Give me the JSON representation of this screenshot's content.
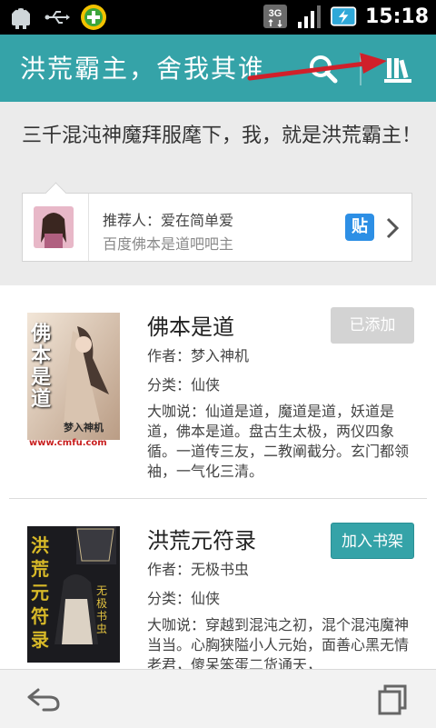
{
  "status_bar": {
    "time": "15:18",
    "network": "3G",
    "icons": [
      "android-icon",
      "usb-icon",
      "app-icon",
      "network-3g-icon",
      "signal-icon",
      "battery-charging-icon"
    ]
  },
  "action_bar": {
    "title": "洪荒霸主，舍我其谁",
    "icons": [
      "search-icon",
      "bookshelf-icon"
    ],
    "accent": "#35a3a8",
    "annotation_arrow_color": "#d0202a"
  },
  "recommendation": {
    "quote": "三千混沌神魔拜服麾下，我，就是洪荒霸主！",
    "recommender": "推荐人：爱在简单爱",
    "forum": "百度佛本是道吧吧主",
    "tie_label": "贴"
  },
  "books": [
    {
      "title": "佛本是道",
      "author": "作者：梦入神机",
      "category": "分类：仙侠",
      "summary": "大咖说：仙道是道，魔道是道，妖道是道，佛本是道。盘古生太极，两仪四象循。一道传三友，二教阐截分。玄门都领袖，一气化三清。",
      "button": "已添加",
      "added": true,
      "cover_text": "佛本是道",
      "cover_author": "梦入神机",
      "cover_url": "www.cmfu.com"
    },
    {
      "title": "洪荒元符录",
      "author": "作者：无极书虫",
      "category": "分类：仙侠",
      "summary": "大咖说：穿越到混沌之初，混个混沌魔神当当。心胸狭隘小人元始，面善心黑无情老君，傻呆笨蛋二货通天，",
      "button": "加入书架",
      "added": false,
      "cover_text": "洪荒元符录",
      "cover_author": "无极书虫"
    }
  ],
  "bottom_bar": {
    "icons": [
      "back-icon",
      "pages-icon"
    ]
  }
}
